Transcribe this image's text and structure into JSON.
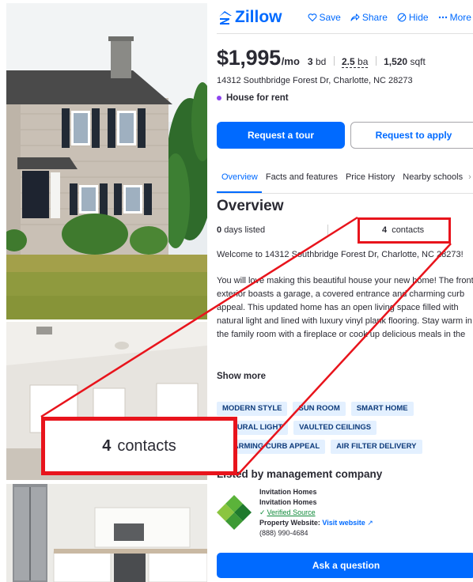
{
  "brand": {
    "name": "Zillow",
    "logo_icon": "zillow-logo-icon",
    "color": "#006aff"
  },
  "header_actions": [
    {
      "label": "Save",
      "icon": "heart-icon"
    },
    {
      "label": "Share",
      "icon": "share-icon"
    },
    {
      "label": "Hide",
      "icon": "hide-icon"
    },
    {
      "label": "More",
      "icon": "more-icon"
    }
  ],
  "listing": {
    "price": "$1,995",
    "price_unit": "/mo",
    "beds_value": "3",
    "beds_label": "bd",
    "baths_value": "2.5",
    "baths_label": "ba",
    "sqft_value": "1,520",
    "sqft_label": "sqft",
    "address": "14312 Southbridge Forest Dr, Charlotte, NC 28273",
    "status": "House for rent",
    "status_color": "#8e44f0"
  },
  "buttons": {
    "tour": "Request a tour",
    "apply": "Request to apply",
    "ask": "Ask a question"
  },
  "tabs": [
    "Overview",
    "Facts and features",
    "Price History",
    "Nearby schools"
  ],
  "overview": {
    "title": "Overview",
    "days_value": "0",
    "days_label": "days listed",
    "contacts_value": "4",
    "contacts_label": "contacts",
    "description_intro": "Welcome to 14312 Southbridge Forest Dr, Charlotte, NC 28273!",
    "description_body": "You will love making this beautiful house your new home! The front exterior boasts a garage, a covered entrance and charming curb appeal. This updated home has an open living space filled with natural light and lined with luxury vinyl plank flooring. Stay warm in the family room with a fireplace or cook up delicious meals in the spacious kitchen that has stainless",
    "show_more": "Show more"
  },
  "features": [
    "MODERN STYLE",
    "SUN ROOM",
    "SMART HOME",
    "NATURAL LIGHT",
    "VAULTED CEILINGS",
    "CHARMING CURB APPEAL",
    "AIR FILTER DELIVERY"
  ],
  "management": {
    "title": "Listed by management company",
    "company_name": "Invitation Homes",
    "company_name_2": "Invitation Homes",
    "verified_label": "Verified Source",
    "website_prefix": "Property Website:",
    "website_link": "Visit website",
    "phone": "(888) 990-4684"
  },
  "annotation": {
    "zoom_value": "4",
    "zoom_label": "contacts",
    "color": "#e8141c"
  }
}
